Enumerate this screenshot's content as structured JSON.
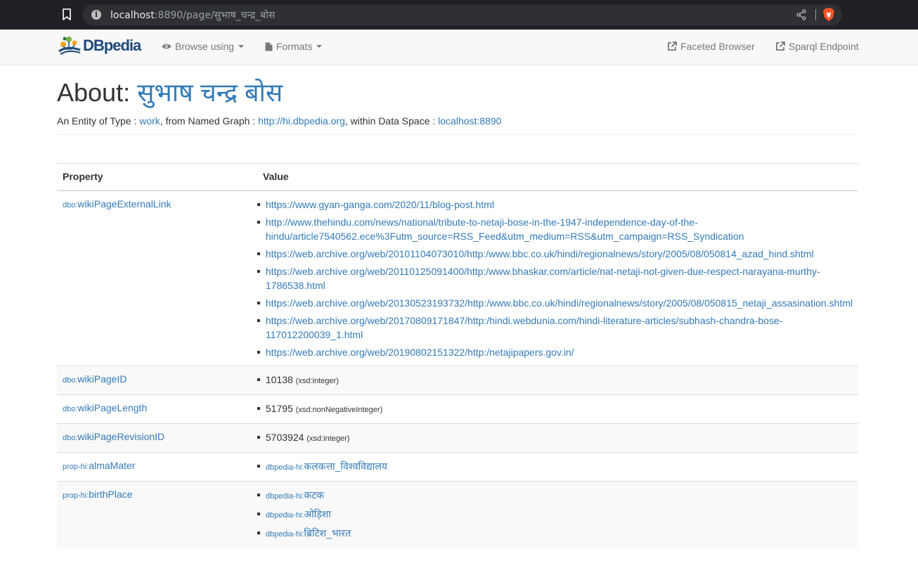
{
  "browser": {
    "url_host": "localhost",
    "url_rest": ":8890/page/सुभाष_चन्द्र_बोस"
  },
  "navbar": {
    "brand": "DBpedia",
    "browse_label": "Browse using",
    "formats_label": "Formats",
    "faceted_label": "Faceted Browser",
    "sparql_label": "Sparql Endpoint"
  },
  "header": {
    "about_prefix": "About: ",
    "title": "सुभाष चन्द्र बोस",
    "entity_text_1": "An Entity of Type : ",
    "entity_type": "work",
    "entity_text_2": ", from Named Graph : ",
    "graph": "http://hi.dbpedia.org",
    "entity_text_3": ", within Data Space : ",
    "space": "localhost:8890"
  },
  "table": {
    "col_property": "Property",
    "col_value": "Value",
    "rows": [
      {
        "prefix": "dbo:",
        "name": "wikiPageExternalLink",
        "values": [
          "https://www.gyan-ganga.com/2020/11/blog-post.html",
          "http://www.thehindu.com/news/national/tribute-to-netaji-bose-in-the-1947-independence-day-of-the-hindu/article7540562.ece%3Futm_source=RSS_Feed&utm_medium=RSS&utm_campaign=RSS_Syndication",
          "https://web.archive.org/web/20101104073010/http:/www.bbc.co.uk/hindi/regionalnews/story/2005/08/050814_azad_hind.shtml",
          "https://web.archive.org/web/20110125091400/http:/www.bhaskar.com/article/nat-netaji-not-given-due-respect-narayana-murthy-1786538.html",
          "https://web.archive.org/web/20130523193732/http:/www.bbc.co.uk/hindi/regionalnews/story/2005/08/050815_netaji_assasination.shtml",
          "https://web.archive.org/web/20170809171847/http:/hindi.webdunia.com/hindi-literature-articles/subhash-chandra-bose-117012200039_1.html",
          "https://web.archive.org/web/20190802151322/http:/netajipapers.gov.in/"
        ]
      },
      {
        "prefix": "dbo:",
        "name": "wikiPageID",
        "value": "10138",
        "datatype": "(xsd:integer)"
      },
      {
        "prefix": "dbo:",
        "name": "wikiPageLength",
        "value": "51795",
        "datatype": "(xsd:nonNegativeInteger)"
      },
      {
        "prefix": "dbo:",
        "name": "wikiPageRevisionID",
        "value": "5703924",
        "datatype": "(xsd:integer)"
      },
      {
        "prefix": "prop-hi:",
        "name": "almaMater",
        "values": [
          {
            "prefix": "dbpedia-hi:",
            "name": "कलकत्ता_विश्वविद्यालय"
          }
        ]
      },
      {
        "prefix": "prop-hi:",
        "name": "birthPlace",
        "values": [
          {
            "prefix": "dbpedia-hi:",
            "name": "कटक"
          },
          {
            "prefix": "dbpedia-hi:",
            "name": "ओड़िशा"
          },
          {
            "prefix": "dbpedia-hi:",
            "name": "ब्रिटिश_भारत"
          }
        ]
      }
    ]
  }
}
